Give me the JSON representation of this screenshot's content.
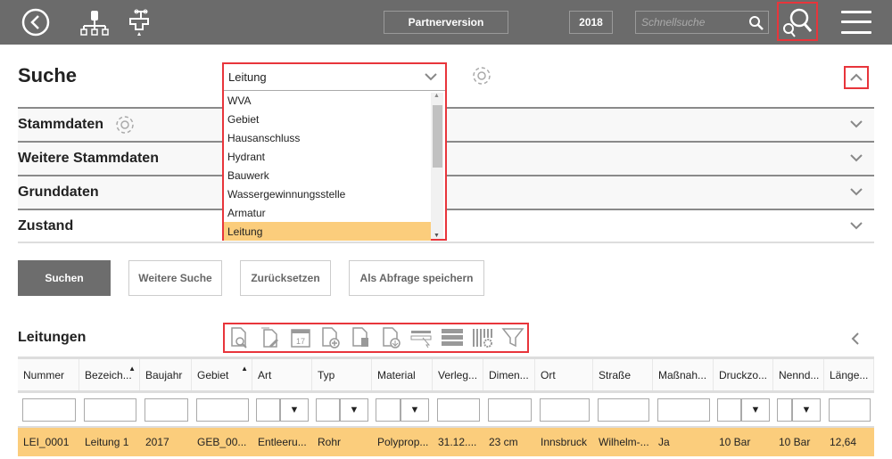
{
  "topbar": {
    "partner_label": "Partnerversion",
    "year": "2018",
    "quicksearch_placeholder": "Schnellsuche"
  },
  "search": {
    "title": "Suche",
    "type_selected": "Leitung",
    "type_options": [
      "WVA",
      "Gebiet",
      "Hausanschluss",
      "Hydrant",
      "Bauwerk",
      "Wassergewinnungsstelle",
      "Armatur",
      "Leitung"
    ]
  },
  "sections": [
    {
      "label": "Stammdaten"
    },
    {
      "label": "Weitere Stammdaten"
    },
    {
      "label": "Grunddaten"
    },
    {
      "label": "Zustand"
    }
  ],
  "buttons": {
    "search": "Suchen",
    "more": "Weitere Suche",
    "reset": "Zurücksetzen",
    "save": "Als Abfrage speichern"
  },
  "results": {
    "title": "Leitungen",
    "toolbar_icons": [
      "document-search-icon",
      "document-edit-icon",
      "calendar-icon",
      "document-add-icon",
      "document-delete-icon",
      "export-icon",
      "select-row-icon",
      "rows-icon",
      "column-settings-icon",
      "filter-icon"
    ],
    "columns": [
      {
        "label": "Nummer",
        "filter": "text"
      },
      {
        "label": "Bezeich...",
        "filter": "text",
        "sorted": true
      },
      {
        "label": "Baujahr",
        "filter": "text"
      },
      {
        "label": "Gebiet",
        "filter": "text",
        "sorted": true
      },
      {
        "label": "Art",
        "filter": "select"
      },
      {
        "label": "Typ",
        "filter": "select"
      },
      {
        "label": "Material",
        "filter": "select"
      },
      {
        "label": "Verleg...",
        "filter": "text"
      },
      {
        "label": "Dimen...",
        "filter": "text"
      },
      {
        "label": "Ort",
        "filter": "text"
      },
      {
        "label": "Straße",
        "filter": "text"
      },
      {
        "label": "Maßnah...",
        "filter": "text"
      },
      {
        "label": "Druckzo...",
        "filter": "select"
      },
      {
        "label": "Nennd...",
        "filter": "select"
      },
      {
        "label": "Länge...",
        "filter": "text"
      }
    ],
    "rows": [
      [
        "LEI_0001",
        "Leitung 1",
        "2017",
        "GEB_00...",
        "Entleeru...",
        "Rohr",
        "Polyprop...",
        "31.12....",
        "23 cm",
        "Innsbruck",
        "Wilhelm-...",
        "Ja",
        "10 Bar",
        "10 Bar",
        "12,64"
      ]
    ]
  },
  "colors": {
    "topbar": "#6b6b6b",
    "highlight": "#fbcd7c",
    "focus": "#e8353b"
  }
}
